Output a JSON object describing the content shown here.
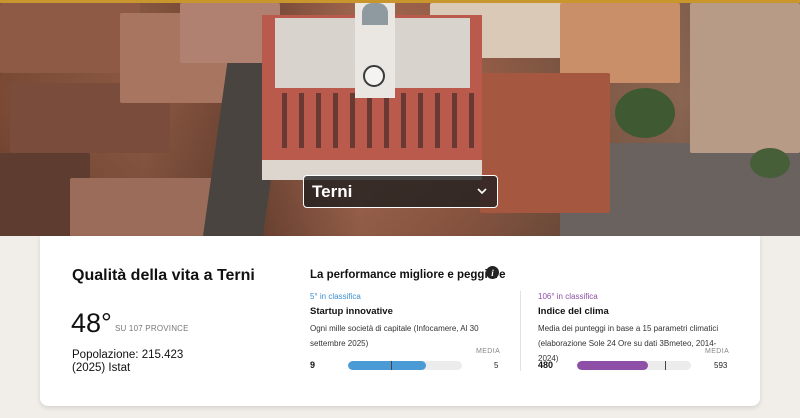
{
  "hero": {
    "city_select": {
      "value": "Terni"
    }
  },
  "card": {
    "title": "Qualità della vita a Terni",
    "score": "48°",
    "score_sub": "SU 107 PROVINCE",
    "population_line1": "Popolazione: 215.423",
    "population_line2": "(2025) Istat",
    "performance_title": "La performance migliore e peggiore",
    "best": {
      "rank": "5° in classifica",
      "name": "Startup innovative",
      "description": "Ogni mille società di capitale (Infocamere, Al 30 settembre 2025)",
      "media_label": "MEDIA",
      "value": "9",
      "media_value": "5",
      "value_fraction": 0.68,
      "media_fraction": 0.38,
      "color": "#4a9ad6"
    },
    "worst": {
      "rank": "106° in classifica",
      "name": "Indice del clima",
      "description": "Media dei punteggi in base a 15 parametri climatici (elaborazione Sole 24 Ore su dati 3Bmeteo, 2014-2024)",
      "media_label": "MEDIA",
      "value": "480",
      "media_value": "593",
      "value_fraction": 0.62,
      "media_fraction": 0.77,
      "color": "#8e4fa6"
    }
  },
  "colors": {
    "accent_strip": "#c9962e",
    "best_rank": "#3f8fd0",
    "worst_rank": "#8e4fa6"
  },
  "icons": {
    "select_chevron": "chevron-down-icon",
    "info": "info-icon"
  }
}
